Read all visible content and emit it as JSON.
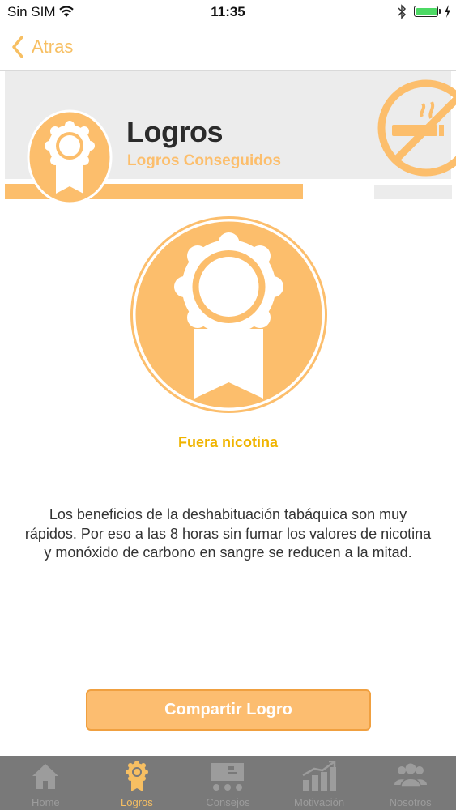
{
  "status_bar": {
    "carrier": "Sin SIM",
    "time": "11:35",
    "battery_color": "#4cd964"
  },
  "nav": {
    "back_label": "Atras",
    "accent": "#f7bf62"
  },
  "header": {
    "title": "Logros",
    "subtitle": "Logros Conseguidos",
    "icon": "no-smoking-icon"
  },
  "achievement": {
    "title": "Fuera nicotina",
    "description": "Los beneficios de la deshabituación tabáquica son muy rápidos. Por eso a las 8 horas sin fumar los valores de nicotina y monóxido de carbono en sangre se reducen a la mitad.",
    "icon": "award-ribbon-icon"
  },
  "share_button": {
    "label": "Compartir Logro"
  },
  "tabs": [
    {
      "label": "Home",
      "icon": "home-icon",
      "active": false
    },
    {
      "label": "Logros",
      "icon": "award-icon",
      "active": true
    },
    {
      "label": "Consejos",
      "icon": "tips-icon",
      "active": false
    },
    {
      "label": "Motivación",
      "icon": "chart-icon",
      "active": false
    },
    {
      "label": "Nosotros",
      "icon": "group-icon",
      "active": false
    }
  ],
  "colors": {
    "primary": "#fcbe6c",
    "title_gold": "#f0b400",
    "tab_bar": "#797979",
    "tab_inactive": "#9c9c9c"
  }
}
